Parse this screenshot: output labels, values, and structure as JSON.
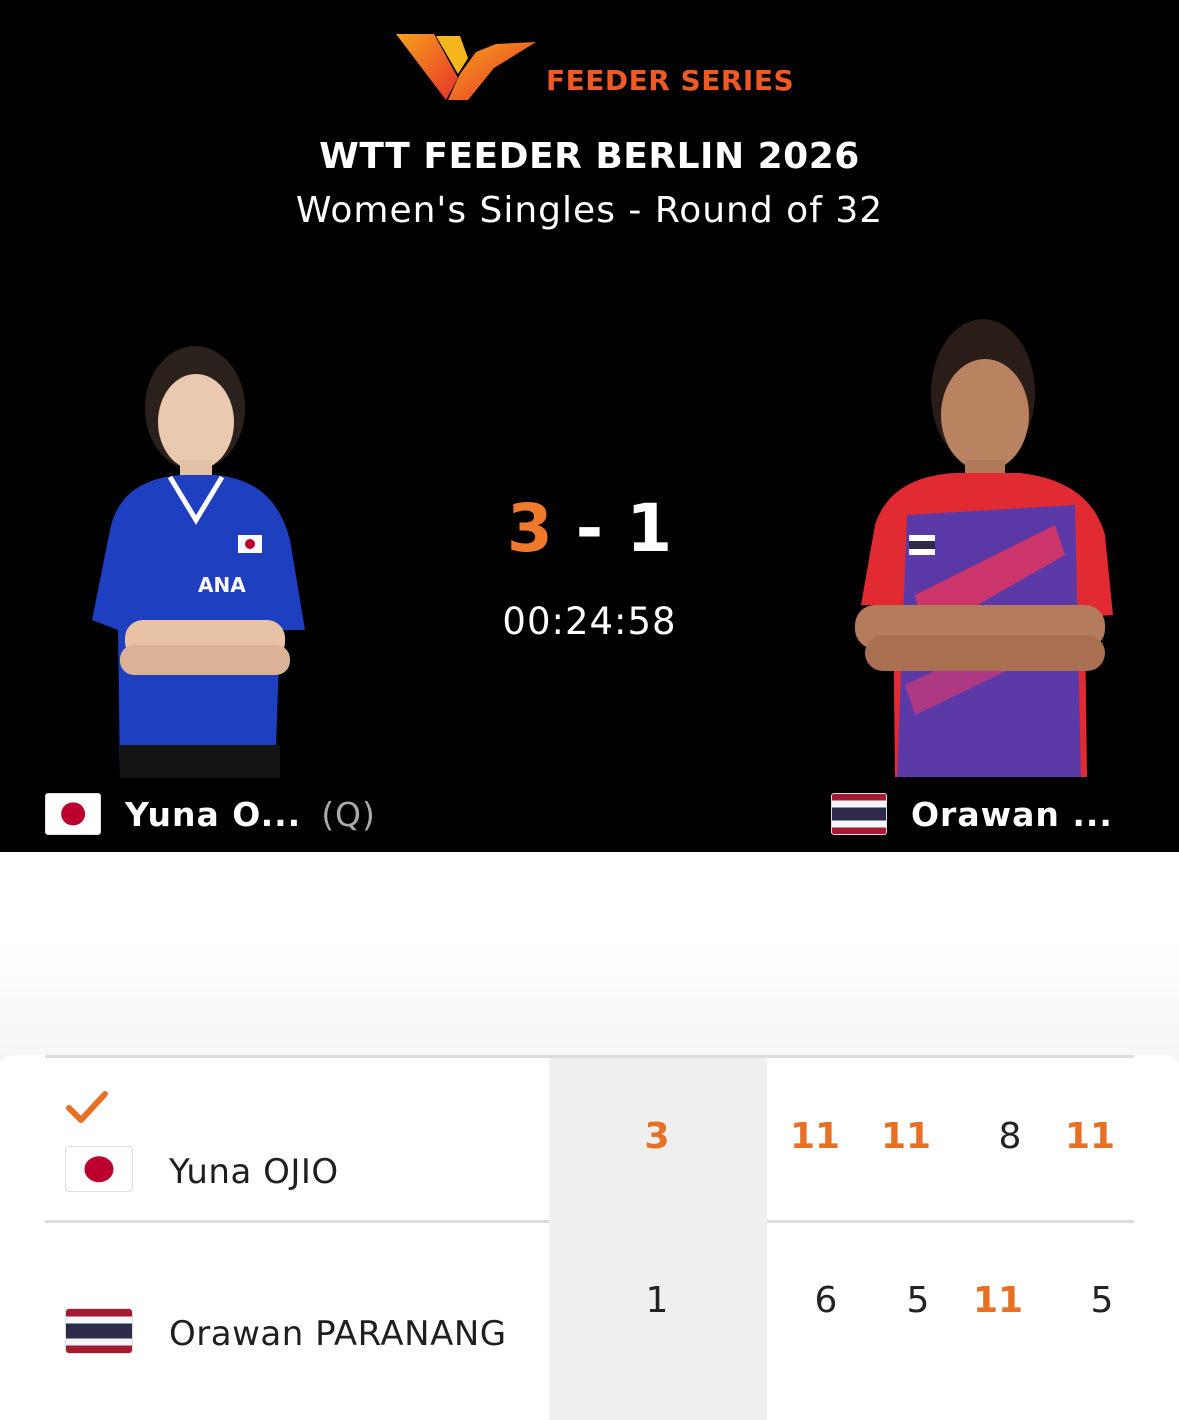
{
  "header": {
    "logo_text": "FEEDER SERIES",
    "event_title": "WTT FEEDER BERLIN 2026",
    "event_subtitle": "Women's Singles - Round of 32"
  },
  "match": {
    "score_left": "3",
    "score_separator": "-",
    "score_right": "1",
    "elapsed": "00:24:58"
  },
  "players_header": {
    "left": {
      "short_name": "Yuna O...",
      "tag": "(Q)",
      "flag": "japan-flag"
    },
    "right": {
      "short_name": "Orawan ...",
      "flag": "thailand-flag"
    }
  },
  "scoreboard": {
    "rows": [
      {
        "name": "Yuna OJIO",
        "flag": "japan-flag",
        "winner": true,
        "sets": "3",
        "games": [
          "11",
          "11",
          "8",
          "11"
        ]
      },
      {
        "name": "Orawan PARANANG",
        "flag": "thailand-flag",
        "winner": false,
        "sets": "1",
        "games": [
          "6",
          "5",
          "11",
          "5"
        ]
      }
    ]
  },
  "colors": {
    "accent": "#e87025",
    "header_bg": "#000000"
  }
}
